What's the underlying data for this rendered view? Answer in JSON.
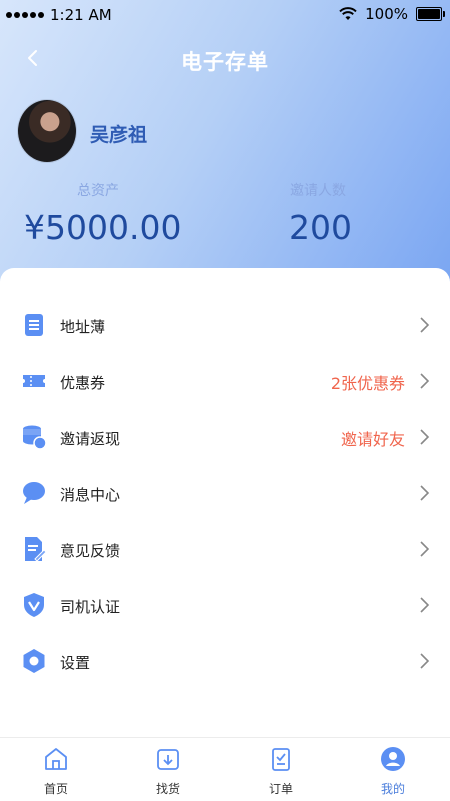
{
  "status_bar": {
    "time": "1:21 AM",
    "battery": "100%",
    "battery_level": 1.0
  },
  "nav": {
    "title": "电子存单"
  },
  "profile": {
    "name": "吴彦祖"
  },
  "stats": {
    "assets_label": "总资产",
    "assets_value": "¥5000.00",
    "invites_label": "邀请人数",
    "invites_value": "200"
  },
  "menu": {
    "items": [
      {
        "label": "地址薄",
        "extra": "",
        "icon": "address-book-icon"
      },
      {
        "label": "优惠券",
        "extra": "2张优惠券",
        "icon": "coupon-icon"
      },
      {
        "label": "邀请返现",
        "extra": "邀请好友",
        "icon": "coins-icon"
      },
      {
        "label": "消息中心",
        "extra": "",
        "icon": "message-bubble-icon"
      },
      {
        "label": "意见反馈",
        "extra": "",
        "icon": "feedback-document-icon"
      },
      {
        "label": "司机认证",
        "extra": "",
        "icon": "shield-v-icon"
      },
      {
        "label": "设置",
        "extra": "",
        "icon": "settings-hexagon-icon"
      }
    ]
  },
  "tabbar": {
    "items": [
      {
        "label": "首页",
        "icon": "home-icon"
      },
      {
        "label": "找货",
        "icon": "download-box-icon"
      },
      {
        "label": "订单",
        "icon": "order-clipboard-icon"
      },
      {
        "label": "我的",
        "icon": "user-profile-icon"
      }
    ],
    "active_index": 3
  },
  "colors": {
    "accent": "#4a7ddb",
    "highlight": "#f0654d",
    "icon_blue": "#5b8ff3"
  }
}
